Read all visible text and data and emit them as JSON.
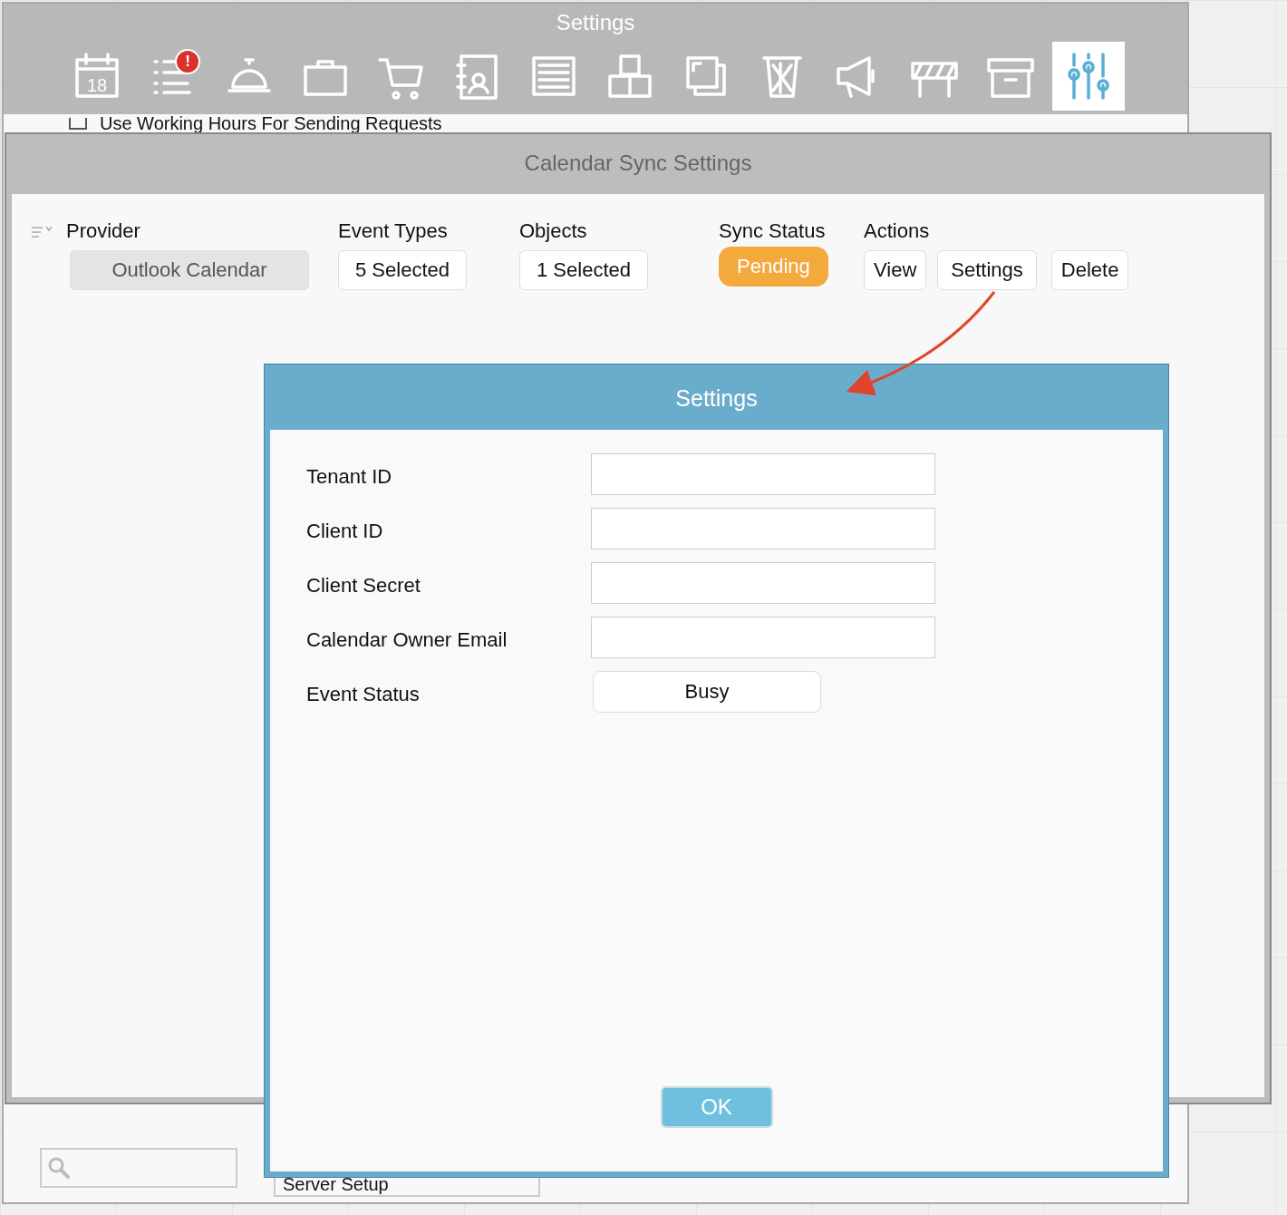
{
  "back_window": {
    "title": "Settings",
    "toolbar": [
      {
        "selected": false,
        "text": "18"
      },
      {
        "selected": false,
        "badge": "!"
      },
      {
        "selected": false
      },
      {
        "selected": false
      },
      {
        "selected": false
      },
      {
        "selected": false
      },
      {
        "selected": false
      },
      {
        "selected": false
      },
      {
        "selected": false
      },
      {
        "selected": false
      },
      {
        "selected": false
      },
      {
        "selected": false
      },
      {
        "selected": false
      },
      {
        "selected": true
      }
    ],
    "checkbox": {
      "label": "Use Working Hours For Sending Requests",
      "checked": false
    },
    "dropdown": {
      "value": "Server Setup"
    }
  },
  "sync_window": {
    "title": "Calendar Sync Settings",
    "columns": [
      "Provider",
      "Event Types",
      "Objects",
      "Sync Status",
      "Actions"
    ],
    "row": {
      "provider": "Outlook Calendar",
      "event_types": "5 Selected",
      "objects": "1 Selected",
      "sync_status": "Pending",
      "actions": [
        "View",
        "Settings",
        "Delete"
      ]
    }
  },
  "dialog": {
    "title": "Settings",
    "fields": [
      {
        "label": "Tenant ID",
        "kind": "text"
      },
      {
        "label": "Client ID",
        "kind": "text"
      },
      {
        "label": "Client Secret",
        "kind": "text"
      },
      {
        "label": "Calendar Owner Email",
        "kind": "text"
      },
      {
        "label": "Event Status",
        "kind": "select",
        "value": "Busy"
      }
    ],
    "ok_button": "OK"
  }
}
